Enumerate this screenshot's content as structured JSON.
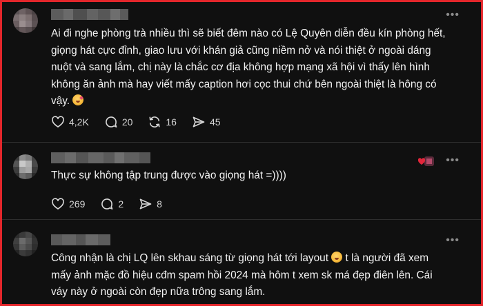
{
  "posts": [
    {
      "text_before_emoji": "Ai đi nghe phòng trà nhiều thì sẽ biết đêm nào có Lệ Quyên diễn đều kín phòng hết, giọng hát cực đỉnh, giao lưu với khán giả cũng niềm nở và nói thiệt ở ngoài dáng nuột và sang lắm, chị này là chắc cơ địa không hợp mạng xã hội vì thấy lên hình không ăn ảnh mà hay viết mấy caption hơi cọc thui chứ bên ngoài thiệt là hông có vậy. ",
      "emoji": "kissing-face-emoji",
      "likes": "4,2K",
      "comments": "20",
      "reposts": "16",
      "shares": "45"
    },
    {
      "text_before_emoji": "Thực sự không tập trung được vào giọng hát =))))",
      "likes": "269",
      "comments": "2",
      "shares": "8",
      "reaction_icon": "heart-avatar-reaction-icon"
    },
    {
      "text_before_emoji": "Công nhận là chị LQ lên skhau sáng từ giọng hát tới layout ",
      "emoji": "smiling-face-emoji",
      "text_after_emoji": " t là người đã xem mấy ảnh mặc đồ hiệu cđm spam hồi 2024 mà hôm t xem sk má đẹp điên lên. Cái váy này ở ngoài còn đẹp nữa trông sang lắm."
    }
  ],
  "icons": {
    "more": "more-options-icon",
    "like": "heart-icon",
    "comment": "comment-bubble-icon",
    "repost": "repost-arrows-icon",
    "share": "send-icon"
  },
  "more_label": "•••",
  "colors": {
    "background": "#101010",
    "frame": "#e3262b",
    "text": "#f3f3f3",
    "muted": "#8c8c8c"
  }
}
